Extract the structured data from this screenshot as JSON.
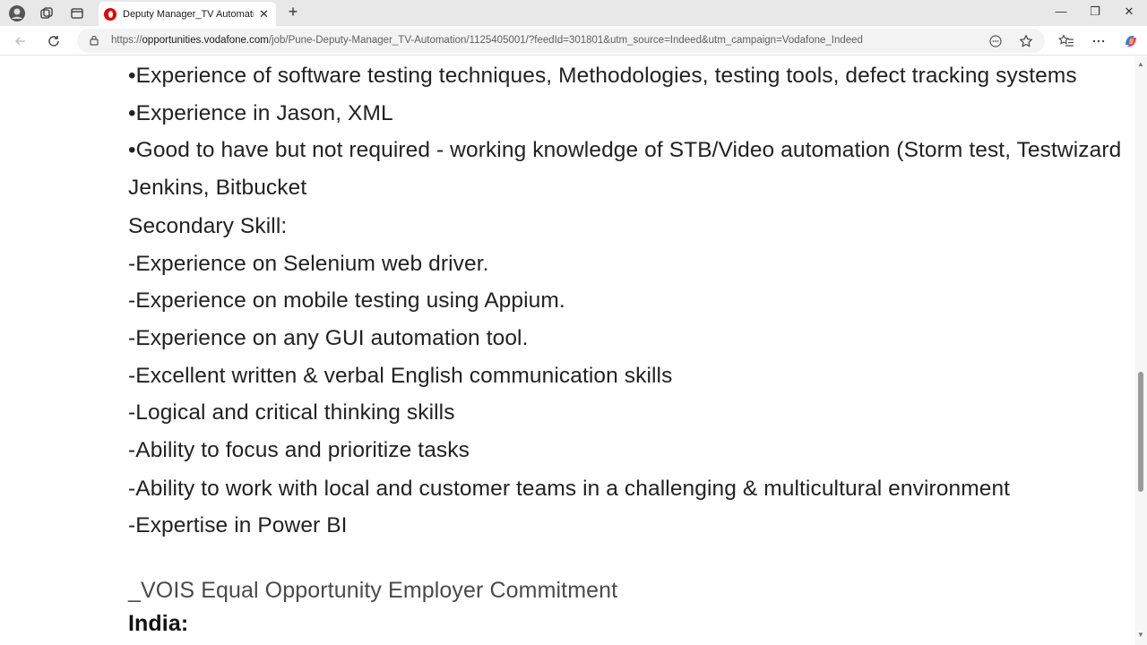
{
  "browser": {
    "tab": {
      "title": "Deputy Manager_TV Automation",
      "close_glyph": "✕"
    },
    "new_tab_glyph": "+",
    "window_controls": {
      "minimize": "—",
      "restore": "❐",
      "close": "✕"
    },
    "url_prefix": "https://",
    "url_host": "opportunities.vodafone.com",
    "url_path": "/job/Pune-Deputy-Manager_TV-Automation/1125405001/?feedId=301801&utm_source=Indeed&utm_campaign=Vodafone_Indeed",
    "icons": [
      "profile-icon",
      "workspaces-icon",
      "tab-actions-icon",
      "back-icon",
      "refresh-icon",
      "lock-icon",
      "read-aloud-icon",
      "favorite-star-icon",
      "favorites-icon",
      "more-icon",
      "copilot-icon"
    ]
  },
  "content": {
    "lines": [
      "•Experience of software testing techniques, Methodologies, testing tools, defect tracking systems",
      "•Experience in Jason, XML",
      "•Good to have but not required - working knowledge of STB/Video automation (Storm test, Testwizard",
      "Jenkins, Bitbucket",
      "Secondary Skill:",
      "-Experience on Selenium web driver.",
      "-Experience on mobile testing using Appium.",
      "-Experience on any GUI automation tool.",
      "-Excellent written & verbal English communication skills",
      "-Logical and critical thinking skills",
      "-Ability to focus and prioritize tasks",
      "-Ability to work with local and customer teams in a challenging & multicultural environment",
      "-Expertise in Power BI"
    ],
    "heading": "_VOIS Equal Opportunity Employer Commitment",
    "subheading": "India:"
  },
  "colors": {
    "tab_bar": "#e8e8e8",
    "brand_red": "#e60000",
    "text": "#222222"
  }
}
